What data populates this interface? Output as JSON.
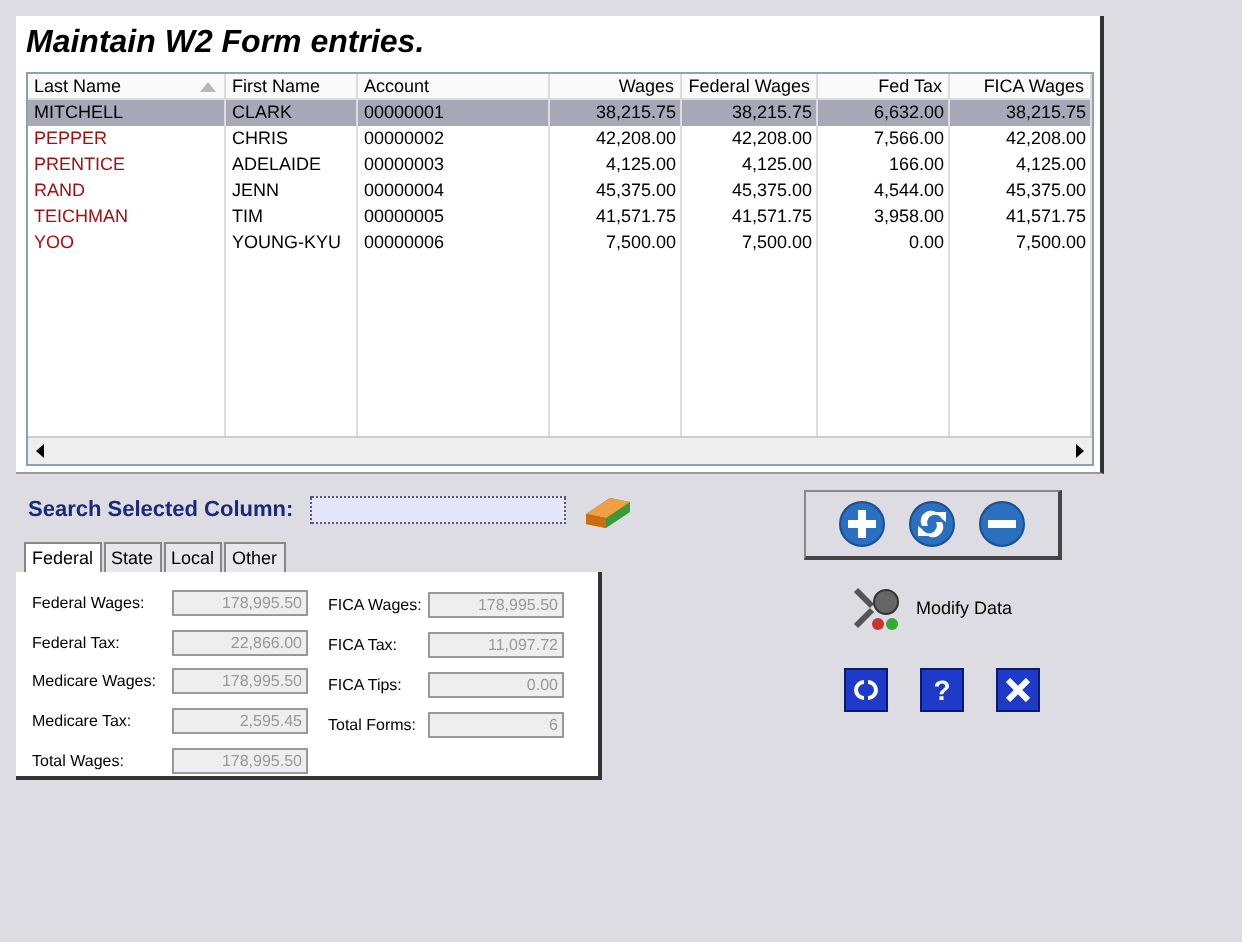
{
  "title": "Maintain W2 Form entries.",
  "table": {
    "columns": [
      {
        "label": "Last Name",
        "sorted": true,
        "kind": "text"
      },
      {
        "label": "First Name",
        "sorted": false,
        "kind": "text"
      },
      {
        "label": "Account",
        "sorted": false,
        "kind": "text"
      },
      {
        "label": "Wages",
        "sorted": false,
        "kind": "money"
      },
      {
        "label": "Federal Wages",
        "sorted": false,
        "kind": "money"
      },
      {
        "label": "Fed Tax",
        "sorted": false,
        "kind": "money"
      },
      {
        "label": "FICA Wages",
        "sorted": false,
        "kind": "money"
      }
    ],
    "rows": [
      {
        "selected": true,
        "cells": [
          "MITCHELL",
          "CLARK",
          "00000001",
          "38,215.75",
          "38,215.75",
          "6,632.00",
          "38,215.75"
        ]
      },
      {
        "selected": false,
        "cells": [
          "PEPPER",
          "CHRIS",
          "00000002",
          "42,208.00",
          "42,208.00",
          "7,566.00",
          "42,208.00"
        ]
      },
      {
        "selected": false,
        "cells": [
          "PRENTICE",
          "ADELAIDE",
          "00000003",
          "4,125.00",
          "4,125.00",
          "166.00",
          "4,125.00"
        ]
      },
      {
        "selected": false,
        "cells": [
          "RAND",
          "JENN",
          "00000004",
          "45,375.00",
          "45,375.00",
          "4,544.00",
          "45,375.00"
        ]
      },
      {
        "selected": false,
        "cells": [
          "TEICHMAN",
          "TIM",
          "00000005",
          "41,571.75",
          "41,571.75",
          "3,958.00",
          "41,571.75"
        ]
      },
      {
        "selected": false,
        "cells": [
          "YOO",
          "YOUNG-KYU",
          "00000006",
          "7,500.00",
          "7,500.00",
          "0.00",
          "7,500.00"
        ]
      }
    ]
  },
  "search": {
    "label": "Search Selected Column:"
  },
  "tabs": [
    {
      "label": "Federal",
      "selected": true
    },
    {
      "label": "State",
      "selected": false
    },
    {
      "label": "Local",
      "selected": false
    },
    {
      "label": "Other",
      "selected": false
    }
  ],
  "totals_left": [
    {
      "label": "Federal Wages:",
      "value": "178,995.50"
    },
    {
      "label": "Federal Tax:",
      "value": "22,866.00"
    },
    {
      "label": "Medicare Wages:",
      "value": "178,995.50"
    },
    {
      "label": "Medicare Tax:",
      "value": "2,595.45"
    },
    {
      "label": "Total Wages:",
      "value": "178,995.50"
    }
  ],
  "totals_right": [
    {
      "label": "FICA Wages:",
      "value": "178,995.50"
    },
    {
      "label": "FICA Tax:",
      "value": "11,097.72"
    },
    {
      "label": "FICA Tips:",
      "value": "0.00"
    },
    {
      "label": "Total Forms:",
      "value": "6"
    }
  ],
  "modify_label": "Modify Data",
  "help_button": "?"
}
